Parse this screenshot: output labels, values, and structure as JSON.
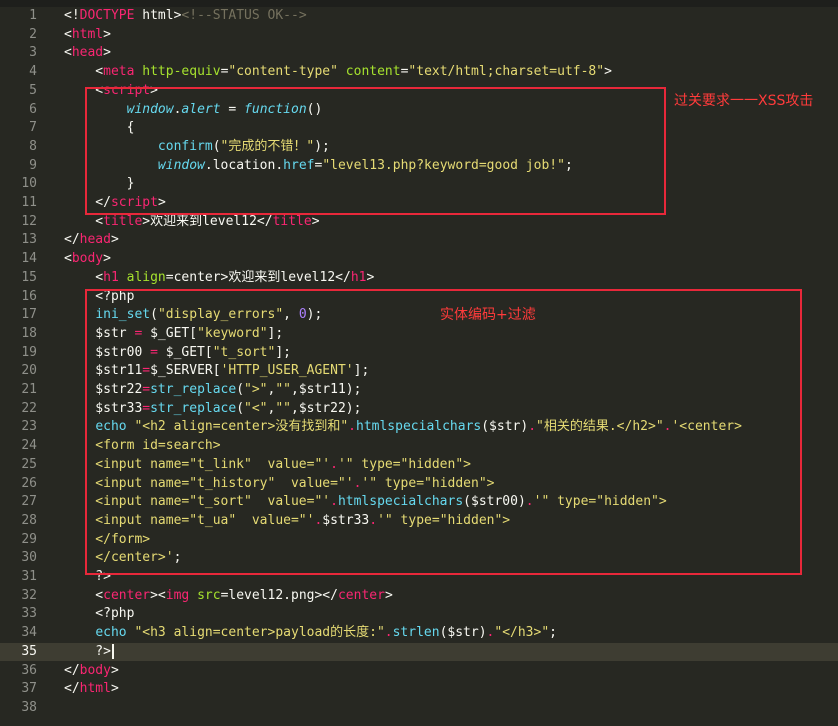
{
  "colors": {
    "background": "#272822",
    "text": "#f8f8f2",
    "keyword": "#f92672",
    "attribute": "#a6e22e",
    "string": "#e6db74",
    "builtin": "#66d9ef",
    "number": "#ae81ff",
    "comment": "#75715e",
    "line_number": "#8f908a",
    "annotation": "#e8283a"
  },
  "editor": {
    "active_line": 35,
    "lines": [
      {
        "n": "1",
        "tokens": [
          [
            "<!",
            "p"
          ],
          [
            "DOCTYPE",
            "k"
          ],
          [
            " html>",
            "p"
          ],
          [
            "<!--STATUS OK-->",
            "c"
          ]
        ]
      },
      {
        "n": "2",
        "tokens": [
          [
            "<",
            "p"
          ],
          [
            "html",
            "k"
          ],
          [
            ">",
            "p"
          ]
        ]
      },
      {
        "n": "3",
        "tokens": [
          [
            "<",
            "p"
          ],
          [
            "head",
            "k"
          ],
          [
            ">",
            "p"
          ]
        ]
      },
      {
        "n": "4",
        "tokens": [
          [
            "    <",
            "p"
          ],
          [
            "meta",
            "k"
          ],
          [
            " ",
            "p"
          ],
          [
            "http-equiv",
            "a"
          ],
          [
            "=",
            "p"
          ],
          [
            "\"content-type\"",
            "s"
          ],
          [
            " ",
            "p"
          ],
          [
            "content",
            "a"
          ],
          [
            "=",
            "p"
          ],
          [
            "\"text/html;charset=utf-8\"",
            "s"
          ],
          [
            ">",
            "p"
          ]
        ]
      },
      {
        "n": "5",
        "tokens": [
          [
            "    <",
            "p"
          ],
          [
            "script",
            "k"
          ],
          [
            ">",
            "p"
          ]
        ]
      },
      {
        "n": "6",
        "tokens": [
          [
            "        ",
            "p"
          ],
          [
            "window",
            "bi"
          ],
          [
            ".",
            "p"
          ],
          [
            "alert",
            "bi"
          ],
          [
            " = ",
            "p"
          ],
          [
            "function",
            "bi"
          ],
          [
            "()",
            "p"
          ]
        ]
      },
      {
        "n": "7",
        "tokens": [
          [
            "        {",
            "p"
          ]
        ]
      },
      {
        "n": "8",
        "tokens": [
          [
            "            ",
            "p"
          ],
          [
            "confirm",
            "b"
          ],
          [
            "(",
            "p"
          ],
          [
            "\"完成的不错！\"",
            "s"
          ],
          [
            ");",
            "p"
          ]
        ]
      },
      {
        "n": "9",
        "tokens": [
          [
            "            ",
            "p"
          ],
          [
            "window",
            "bi"
          ],
          [
            ".location.",
            "p"
          ],
          [
            "href",
            "b"
          ],
          [
            "=",
            "p"
          ],
          [
            "\"level13.php?keyword=good job!\"",
            "s"
          ],
          [
            ";",
            "p"
          ]
        ]
      },
      {
        "n": "10",
        "tokens": [
          [
            "        }",
            "p"
          ]
        ]
      },
      {
        "n": "11",
        "tokens": [
          [
            "    </",
            "p"
          ],
          [
            "script",
            "k"
          ],
          [
            ">",
            "p"
          ]
        ]
      },
      {
        "n": "12",
        "tokens": [
          [
            "    <",
            "p"
          ],
          [
            "title",
            "k"
          ],
          [
            ">欢迎来到level12</",
            "p"
          ],
          [
            "title",
            "k"
          ],
          [
            ">",
            "p"
          ]
        ]
      },
      {
        "n": "13",
        "tokens": [
          [
            "</",
            "p"
          ],
          [
            "head",
            "k"
          ],
          [
            ">",
            "p"
          ]
        ]
      },
      {
        "n": "14",
        "tokens": [
          [
            "<",
            "p"
          ],
          [
            "body",
            "k"
          ],
          [
            ">",
            "p"
          ]
        ]
      },
      {
        "n": "15",
        "tokens": [
          [
            "    <",
            "p"
          ],
          [
            "h1",
            "k"
          ],
          [
            " ",
            "p"
          ],
          [
            "align",
            "a"
          ],
          [
            "=center>欢迎来到level12</",
            "p"
          ],
          [
            "h1",
            "k"
          ],
          [
            ">",
            "p"
          ]
        ]
      },
      {
        "n": "16",
        "tokens": [
          [
            "    <?php",
            "p"
          ]
        ]
      },
      {
        "n": "17",
        "tokens": [
          [
            "    ",
            "p"
          ],
          [
            "ini_set",
            "b"
          ],
          [
            "(",
            "p"
          ],
          [
            "\"display_errors\"",
            "s"
          ],
          [
            ", ",
            "p"
          ],
          [
            "0",
            "n"
          ],
          [
            ");",
            "p"
          ]
        ]
      },
      {
        "n": "18",
        "tokens": [
          [
            "    $str ",
            "p"
          ],
          [
            "=",
            "k"
          ],
          [
            " $_GET[",
            "p"
          ],
          [
            "\"keyword\"",
            "s"
          ],
          [
            "];",
            "p"
          ]
        ]
      },
      {
        "n": "19",
        "tokens": [
          [
            "    $str00 ",
            "p"
          ],
          [
            "=",
            "k"
          ],
          [
            " $_GET[",
            "p"
          ],
          [
            "\"t_sort\"",
            "s"
          ],
          [
            "];",
            "p"
          ]
        ]
      },
      {
        "n": "20",
        "tokens": [
          [
            "    $str11",
            "p"
          ],
          [
            "=",
            "k"
          ],
          [
            "$_SERVER[",
            "p"
          ],
          [
            "'HTTP_USER_AGENT'",
            "s"
          ],
          [
            "];",
            "p"
          ]
        ]
      },
      {
        "n": "21",
        "tokens": [
          [
            "    $str22",
            "p"
          ],
          [
            "=",
            "k"
          ],
          [
            "str_replace",
            "b"
          ],
          [
            "(",
            "p"
          ],
          [
            "\">\"",
            "s"
          ],
          [
            ",",
            "p"
          ],
          [
            "\"\"",
            "s"
          ],
          [
            ",$str11);",
            "p"
          ]
        ]
      },
      {
        "n": "22",
        "tokens": [
          [
            "    $str33",
            "p"
          ],
          [
            "=",
            "k"
          ],
          [
            "str_replace",
            "b"
          ],
          [
            "(",
            "p"
          ],
          [
            "\"<\"",
            "s"
          ],
          [
            ",",
            "p"
          ],
          [
            "\"\"",
            "s"
          ],
          [
            ",$str22);",
            "p"
          ]
        ]
      },
      {
        "n": "23",
        "tokens": [
          [
            "    ",
            "p"
          ],
          [
            "echo",
            "b"
          ],
          [
            " ",
            "p"
          ],
          [
            "\"<h2 align=center>没有找到和\"",
            "s"
          ],
          [
            ".",
            "k"
          ],
          [
            "htmlspecialchars",
            "b"
          ],
          [
            "($str)",
            "p"
          ],
          [
            ".",
            "k"
          ],
          [
            "\"相关的结果.</h2>\"",
            "s"
          ],
          [
            ".",
            "k"
          ],
          [
            "'<center>",
            "s"
          ]
        ]
      },
      {
        "n": "24",
        "tokens": [
          [
            "    <form id=search>",
            "s"
          ]
        ]
      },
      {
        "n": "25",
        "tokens": [
          [
            "    <input name=\"t_link\"  value=\"'",
            "s"
          ],
          [
            ".",
            "k"
          ],
          [
            "'\" type=\"hidden\">",
            "s"
          ]
        ]
      },
      {
        "n": "26",
        "tokens": [
          [
            "    <input name=\"t_history\"  value=\"'",
            "s"
          ],
          [
            ".",
            "k"
          ],
          [
            "'\" type=\"hidden\">",
            "s"
          ]
        ]
      },
      {
        "n": "27",
        "tokens": [
          [
            "    <input name=\"t_sort\"  value=\"'",
            "s"
          ],
          [
            ".",
            "k"
          ],
          [
            "htmlspecialchars",
            "b"
          ],
          [
            "($str00)",
            "p"
          ],
          [
            ".",
            "k"
          ],
          [
            "'\" type=\"hidden\">",
            "s"
          ]
        ]
      },
      {
        "n": "28",
        "tokens": [
          [
            "    <input name=\"t_ua\"  value=\"'",
            "s"
          ],
          [
            ".",
            "k"
          ],
          [
            "$str33",
            "p"
          ],
          [
            ".",
            "k"
          ],
          [
            "'\" type=\"hidden\">",
            "s"
          ]
        ]
      },
      {
        "n": "29",
        "tokens": [
          [
            "    </form>",
            "s"
          ]
        ]
      },
      {
        "n": "30",
        "tokens": [
          [
            "    </center>'",
            "s"
          ],
          [
            ";",
            "p"
          ]
        ]
      },
      {
        "n": "31",
        "tokens": [
          [
            "    ?>",
            "p"
          ]
        ]
      },
      {
        "n": "32",
        "tokens": [
          [
            "    <",
            "p"
          ],
          [
            "center",
            "k"
          ],
          [
            "><",
            "p"
          ],
          [
            "img",
            "k"
          ],
          [
            " ",
            "p"
          ],
          [
            "src",
            "a"
          ],
          [
            "=level12.png></",
            "p"
          ],
          [
            "center",
            "k"
          ],
          [
            ">",
            "p"
          ]
        ]
      },
      {
        "n": "33",
        "tokens": [
          [
            "    <?php",
            "p"
          ]
        ]
      },
      {
        "n": "34",
        "tokens": [
          [
            "    ",
            "p"
          ],
          [
            "echo",
            "b"
          ],
          [
            " ",
            "p"
          ],
          [
            "\"<h3 align=center>payload的长度:\"",
            "s"
          ],
          [
            ".",
            "k"
          ],
          [
            "strlen",
            "b"
          ],
          [
            "($str)",
            "p"
          ],
          [
            ".",
            "k"
          ],
          [
            "\"</h3>\"",
            "s"
          ],
          [
            ";",
            "p"
          ]
        ]
      },
      {
        "n": "35",
        "tokens": [
          [
            "    ?>",
            "p"
          ]
        ]
      },
      {
        "n": "36",
        "tokens": [
          [
            "</",
            "p"
          ],
          [
            "body",
            "k"
          ],
          [
            ">",
            "p"
          ]
        ]
      },
      {
        "n": "37",
        "tokens": [
          [
            "</",
            "p"
          ],
          [
            "html",
            "k"
          ],
          [
            ">",
            "p"
          ]
        ]
      },
      {
        "n": "38",
        "tokens": []
      }
    ]
  },
  "annotations": {
    "note_top": "过关要求一一XSS攻击",
    "note_php": "实体编码+过滤"
  }
}
